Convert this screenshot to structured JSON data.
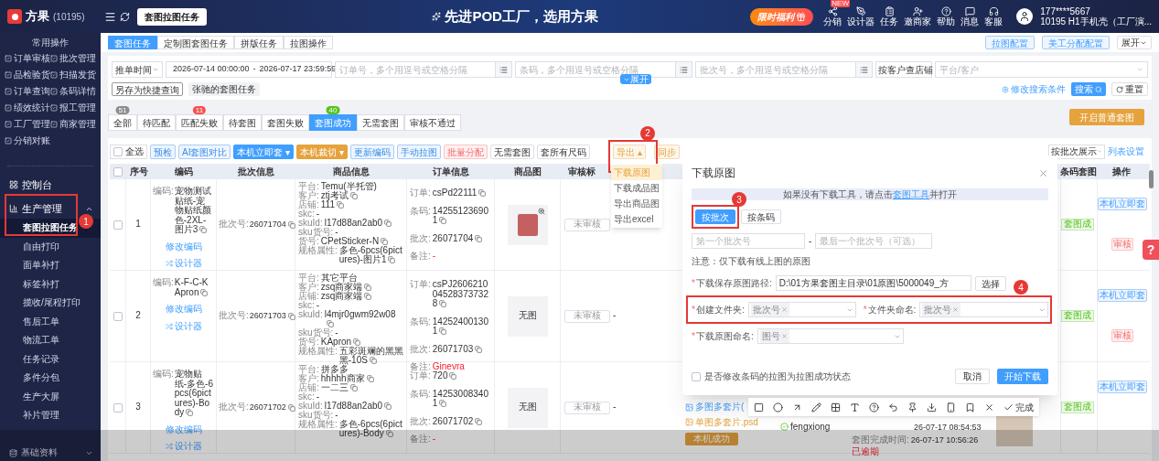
{
  "brand": {
    "name": "方果",
    "code": "(10195)"
  },
  "header": {
    "page_tag": "套图拉图任务",
    "slogan": "先进POD工厂，选用方果",
    "promo": "限时福利",
    "tools": [
      {
        "kind": "share",
        "label": "分销",
        "badge": "NEW"
      },
      {
        "kind": "pen",
        "label": "设计器"
      },
      {
        "kind": "task",
        "label": "任务"
      },
      {
        "kind": "invite",
        "label": "邀商家"
      },
      {
        "kind": "help",
        "label": "帮助"
      },
      {
        "kind": "message",
        "label": "消息"
      },
      {
        "kind": "service",
        "label": "客服"
      }
    ],
    "user": {
      "phone": "177****5667",
      "org": "10195 H1手机壳（工厂演..."
    }
  },
  "sidebar": {
    "quick_title": "常用操作",
    "quick": [
      "订单审核",
      "批次管理",
      "品检验货",
      "扫描发货",
      "订单查询",
      "条码详情",
      "绩效统计",
      "报工管理",
      "工厂管理",
      "商家管理",
      "分销对账"
    ],
    "console": "控制台",
    "group": {
      "label": "生产管理",
      "expanded": true,
      "children": [
        {
          "label": "套图拉图任务",
          "selected": true
        },
        {
          "label": "自由打印",
          "selected": false
        },
        {
          "label": "面单补打",
          "selected": false
        },
        {
          "label": "标签补打",
          "selected": false
        },
        {
          "label": "揽收/尾程打印",
          "selected": false
        },
        {
          "label": "售后工单",
          "selected": false
        },
        {
          "label": "物流工单",
          "selected": false
        },
        {
          "label": "任务记录",
          "selected": false
        },
        {
          "label": "多件分包",
          "selected": false
        },
        {
          "label": "生产大屏",
          "selected": false
        },
        {
          "label": "补片管理",
          "selected": false
        }
      ]
    },
    "footer_group": {
      "label": "基础资料",
      "expanded": false
    }
  },
  "tabs": [
    {
      "label": "套图任务",
      "selected": true
    },
    {
      "label": "定制图套图任务",
      "selected": false
    },
    {
      "label": "拼版任务",
      "selected": false
    },
    {
      "label": "拉图操作",
      "selected": false
    }
  ],
  "tab_actions": [
    "拉图配置",
    "美工分配配置"
  ],
  "expand_menu": "展开",
  "filters": {
    "time_type": "推单时间",
    "date_from": "2026-07-14 00:00:00",
    "date_sep": "-",
    "date_to": "2026-07-17 23:59:59",
    "order_placeholder": "订单号，多个用逗号或空格分隔",
    "barcode_placeholder": "条码，多个用逗号或空格分隔",
    "batch_placeholder": "批次号，多个用逗号或空格分隔",
    "shop_mode": "按客户查店铺",
    "platform_placeholder": "平台/客户",
    "save_query": "另存为快捷查询",
    "saved_query": "张驰的套图任务",
    "expand": "展开",
    "edit_conditions": "修改搜索条件",
    "search": "搜索",
    "reset": "重置"
  },
  "status_tabs": [
    {
      "label": "全部",
      "count": "51",
      "color": "#8c8c8c",
      "selected": false
    },
    {
      "label": "待匹配",
      "selected": false
    },
    {
      "label": "匹配失败",
      "count": "11",
      "color": "#f5504f",
      "selected": false
    },
    {
      "label": "待套图",
      "selected": false
    },
    {
      "label": "套图失败",
      "selected": false
    },
    {
      "label": "套图成功",
      "count": "40",
      "color": "#52c41a",
      "selected": true
    },
    {
      "label": "无需套图",
      "selected": false
    },
    {
      "label": "审核不通过",
      "selected": false
    }
  ],
  "start_button": "开启普通套图",
  "toolbar": {
    "select_all": {
      "label": "全选",
      "checked": false
    },
    "buttons": [
      {
        "kind": "light",
        "label": "预检"
      },
      {
        "kind": "light",
        "label": "AI套图对比"
      },
      {
        "kind": "primary",
        "label": "本机立即套 ▾"
      },
      {
        "kind": "warning",
        "label": "本机裁切 ▾"
      },
      {
        "kind": "light",
        "label": "更新编码"
      },
      {
        "kind": "light",
        "label": "手动拉图"
      },
      {
        "kind": "danger",
        "label": "批量分配"
      },
      {
        "kind": "plain",
        "label": "无需套图"
      },
      {
        "kind": "plain",
        "label": "套所有尺码"
      },
      {
        "kind": "export",
        "label": "导出 ▴"
      },
      {
        "kind": "warn_light",
        "label": "同步"
      }
    ],
    "view_mode": "按批次展示",
    "column_settings": "列表设置"
  },
  "table": {
    "header_checked": false,
    "columns": [
      "序号",
      "编码",
      "批次信息",
      "商品信息",
      "订单信息",
      "商品图",
      "审核标",
      "条码套图",
      "操作"
    ],
    "rows": [
      {
        "checked": false,
        "seq": "1",
        "code_label": "编码:",
        "code": "宠物测试贴纸-宠物贴纸颜色-2XL-图片3",
        "edit": "修改编码",
        "designer": "设计器",
        "batch_label": "批次号:",
        "batch": "26071704",
        "product": [
          {
            "k": "平台:",
            "v": "Temu(半托管)",
            "copy": false
          },
          {
            "k": "客户:",
            "v": "ztj考试",
            "copy": true
          },
          {
            "k": "店铺:",
            "v": "111",
            "copy": true
          },
          {
            "k": "skc:",
            "v": "-",
            "copy": false
          },
          {
            "k": "skuId:",
            "v": "l17d88an2ab0",
            "copy": true
          },
          {
            "k": "sku货号:",
            "v": "-",
            "copy": false
          },
          {
            "k": "货号:",
            "v": "CPetSticker-N",
            "copy": true
          },
          {
            "k": "规格属性:",
            "v": "多色-6pcs(6pictures)-图片1",
            "copy": true
          }
        ],
        "order": [
          {
            "kind": "plain",
            "k": "订单:",
            "v": "csPd22111"
          },
          {
            "kind": "plain",
            "k": "条码:",
            "v": "142551236901"
          },
          {
            "kind": "plain",
            "k": "批次:",
            "v": "26071704"
          },
          {
            "kind": "remark",
            "k": "备注:",
            "v": "-"
          }
        ],
        "image": {
          "kind": "photo"
        },
        "review": "未审核",
        "review_extra": "",
        "status": "套图成",
        "actions": [
          "本机立即套",
          "审核"
        ]
      },
      {
        "checked": false,
        "seq": "2",
        "code_label": "编码:",
        "code": "K-F-C-KApron",
        "edit": "修改编码",
        "designer": "设计器",
        "batch_label": "批次号:",
        "batch": "26071703",
        "product": [
          {
            "k": "平台:",
            "v": "其它平台",
            "copy": false
          },
          {
            "k": "客户:",
            "v": "zsq商家端",
            "copy": true
          },
          {
            "k": "店铺:",
            "v": "zsq商家端",
            "copy": true
          },
          {
            "k": "skc:",
            "v": "-",
            "copy": false
          },
          {
            "k": "skuId:",
            "v": "l4mjr0gwm92w08",
            "copy": true
          },
          {
            "k": "sku货号:",
            "v": "-",
            "copy": false
          },
          {
            "k": "货号:",
            "v": "KApron",
            "copy": true
          },
          {
            "k": "规格属性:",
            "v": "五彩斑斓的黑黑黑-10S",
            "copy": true
          }
        ],
        "order": [
          {
            "kind": "plain",
            "k": "订单:",
            "v": "csPJ2606210045283737328"
          },
          {
            "kind": "plain",
            "k": "条码:",
            "v": "142524001301"
          },
          {
            "kind": "plain",
            "k": "批次:",
            "v": "26071703"
          },
          {
            "kind": "remark",
            "k": "备注:",
            "v": "Ginevra"
          }
        ],
        "image": {
          "kind": "none",
          "label": "无图"
        },
        "review": "未审核",
        "review_extra": "-",
        "status": "套图成",
        "actions": [
          "本机立即套",
          "审核"
        ]
      },
      {
        "checked": false,
        "seq": "3",
        "code_label": "编码:",
        "code": "宠物贴纸-多色-6pcs(6pictures)-Body",
        "edit": "修改编码",
        "designer": "设计器",
        "batch_label": "批次号:",
        "batch": "26071702",
        "product": [
          {
            "k": "平台:",
            "v": "拼多多",
            "copy": false
          },
          {
            "k": "客户:",
            "v": "hhhhh商家",
            "copy": true
          },
          {
            "k": "店铺:",
            "v": "一二三",
            "copy": true
          },
          {
            "k": "skc:",
            "v": "-",
            "copy": false
          },
          {
            "k": "skuId:",
            "v": "l17d88an2ab0",
            "copy": true
          },
          {
            "k": "sku货号:",
            "v": "-",
            "copy": false
          },
          {
            "k": "规格属性:",
            "v": "多色-6pcs(6pictures)-Body",
            "copy": true
          }
        ],
        "order": [
          {
            "kind": "plain",
            "k": "订单:",
            "v": "720"
          },
          {
            "kind": "plain",
            "k": "条码:",
            "v": "142530083401"
          },
          {
            "kind": "plain",
            "k": "批次:",
            "v": "26071702"
          },
          {
            "kind": "remark",
            "k": "备注:",
            "v": "-"
          }
        ],
        "image": {
          "kind": "none",
          "label": "无图"
        },
        "review": "未审核",
        "review_extra": "-",
        "status": "套图成",
        "actions": [
          "本机立即套"
        ],
        "extra": {
          "files": [
            "多图多套片(",
            "单图多套片.psd"
          ],
          "file_action": "本机成功",
          "operator": "fengxiong",
          "time": "26-07-17 08:54:53",
          "done_label": "套图完成时间:",
          "done": "26-07-17 10:56:26",
          "overdue": "已逾期"
        }
      }
    ]
  },
  "export_menu": [
    {
      "label": "下载原图",
      "selected": true
    },
    {
      "label": "下载成品图",
      "selected": false
    },
    {
      "label": "导出商品图",
      "selected": false
    },
    {
      "label": "导出excel",
      "selected": false
    }
  ],
  "dialog": {
    "title": "下载原图",
    "notice": "如果没有下载工具，请点击",
    "notice_link": "套图工具",
    "notice_tail": "并打开",
    "tabs": [
      {
        "label": "按批次",
        "selected": true
      },
      {
        "label": "按条码",
        "selected": false
      }
    ],
    "first_placeholder": "第一个批次号",
    "range_sep": "-",
    "last_placeholder": "最后一个批次号（可选）",
    "note": "注意：仅下载有线上图的原图",
    "required_mark": "*",
    "path_label": "下载保存原图路径:",
    "path": "D:\\01方果套图主目录\\01原图\\5000049_方",
    "choose": "选择",
    "folder_label": "创建文件夹:",
    "folder_tag": "批次号",
    "folder_name_label": "文件夹命名:",
    "folder_name_tag": "批次号",
    "file_name_label": "下载原图命名:",
    "file_name_tag": "图号",
    "switch": {
      "label": "是否修改条码的拉图为拉图成功状态",
      "checked": false
    },
    "cancel": "取消",
    "confirm": "开始下载"
  },
  "annotations": [
    "1",
    "2",
    "3",
    "4"
  ],
  "capture_toolbar": {
    "done": "完成"
  },
  "help": "?"
}
